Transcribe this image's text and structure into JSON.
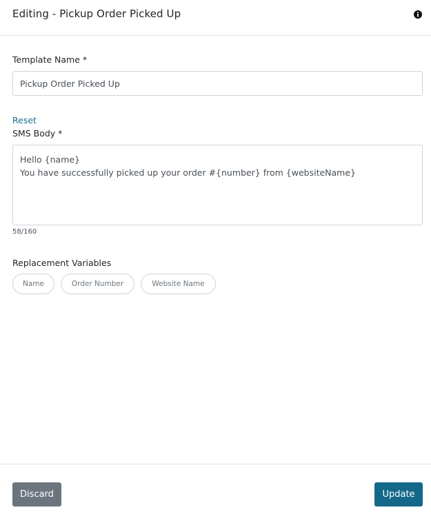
{
  "header": {
    "title": "Editing - Pickup Order Picked Up",
    "info_icon": "info-icon"
  },
  "form": {
    "template_name_label": "Template Name *",
    "template_name_value": "Pickup Order Picked Up",
    "reset_label": "Reset",
    "sms_body_label": "SMS Body *",
    "sms_body_value": "Hello {name}\nYou have successfully picked up your order #{number} from {websiteName}",
    "char_count": "58/160",
    "replacement_variables_label": "Replacement Variables",
    "variables": [
      "Name",
      "Order Number",
      "Website Name"
    ]
  },
  "footer": {
    "discard_label": "Discard",
    "update_label": "Update"
  },
  "colors": {
    "link": "#1d6e8a",
    "primary_button": "#14698a",
    "secondary_button": "#6c757d",
    "border": "#ced4da"
  }
}
